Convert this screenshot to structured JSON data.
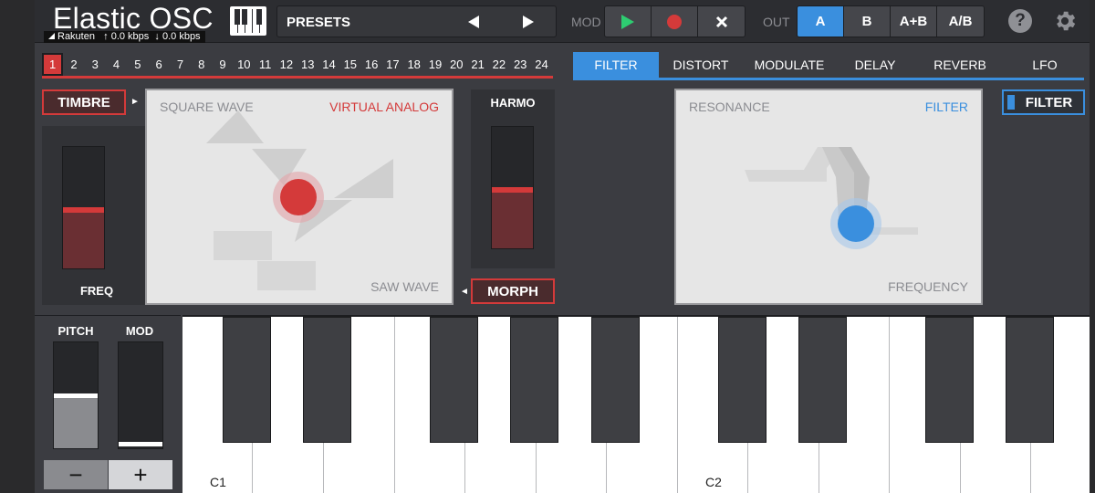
{
  "header": {
    "title": "Elastic OSC",
    "status_bar": {
      "carrier": "Rakuten",
      "upload": "↑ 0.0 kbps",
      "download": "↓ 0.0 kbps"
    },
    "presets_label": "PRESETS",
    "mod_label": "MOD",
    "out_label": "OUT",
    "out_options": [
      "A",
      "B",
      "A+B",
      "A/B"
    ],
    "out_selected": "A"
  },
  "channels": {
    "items": [
      "1",
      "2",
      "3",
      "4",
      "5",
      "6",
      "7",
      "8",
      "9",
      "10",
      "11",
      "12",
      "13",
      "14",
      "15",
      "16",
      "17",
      "18",
      "19",
      "20",
      "21",
      "22",
      "23",
      "24"
    ],
    "selected": "1"
  },
  "tabs": {
    "items": [
      "FILTER",
      "DISTORT",
      "MODULATE",
      "DELAY",
      "REVERB",
      "LFO"
    ],
    "selected": "FILTER"
  },
  "oscillator": {
    "timbre_label": "TIMBRE",
    "freq_label": "FREQ",
    "harmo_label": "HARMO",
    "morph_label": "MORPH",
    "freq_level": 0.5,
    "harmo_level": 0.5,
    "pad_top_left": "SQUARE WAVE",
    "pad_top_right": "VIRTUAL ANALOG",
    "pad_bottom_right": "SAW WAVE"
  },
  "filter": {
    "pad_top_left": "RESONANCE",
    "pad_top_right": "FILTER",
    "pad_bottom_right": "FREQUENCY",
    "toggle_label": "FILTER"
  },
  "controls": {
    "pitch_label": "PITCH",
    "mod_label": "MOD",
    "minus": "−",
    "plus": "+"
  },
  "keyboard": {
    "labels": [
      "C1",
      "C2"
    ]
  },
  "colors": {
    "accent_red": "#d43a3a",
    "accent_blue": "#3a8fde",
    "play_green": "#2ecc71"
  }
}
